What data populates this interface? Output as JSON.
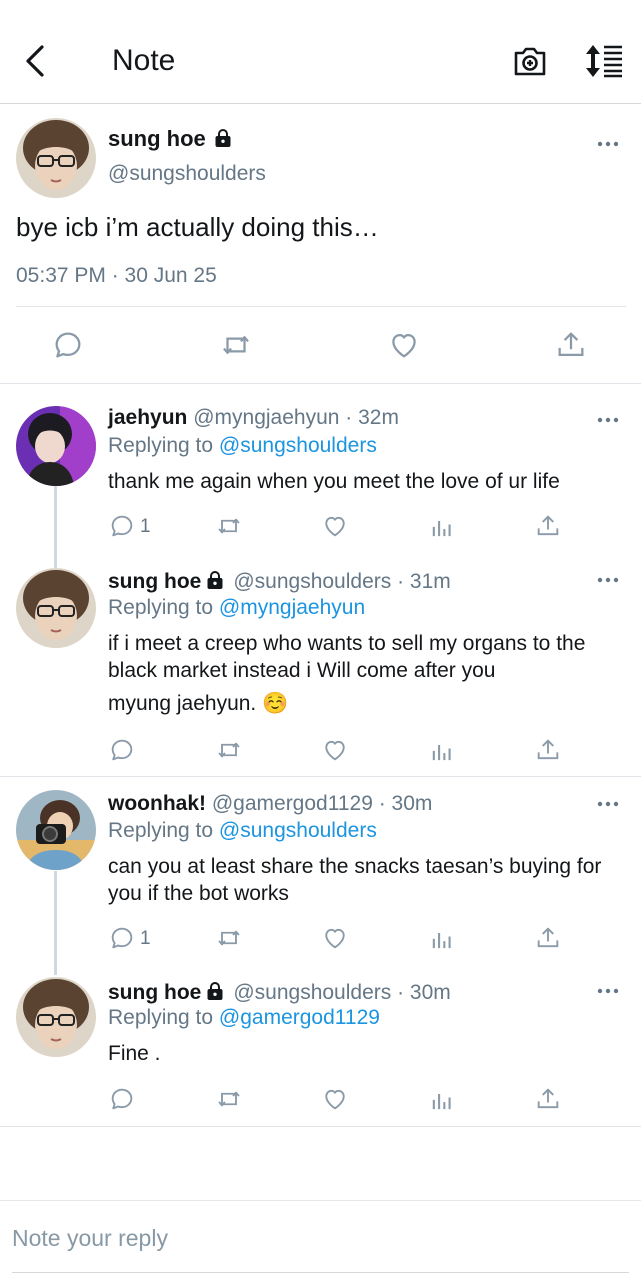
{
  "header": {
    "title": "Note",
    "back_icon": "chevron-left-icon",
    "camera_icon": "camera-icon",
    "sort_icon": "sort-icon"
  },
  "main_note": {
    "name": "sung hoe",
    "handle": "@sungshoulders",
    "text": "bye icb i’m actually doing this…",
    "timestamp": "05:37 PM · 30 Jun 25"
  },
  "replies": [
    {
      "name": "jaehyun",
      "handle": "@myngjaehyun",
      "time": "· 32m",
      "replying_prefix": "Replying to ",
      "replying_to": "@sungshoulders",
      "text": "thank me again when you meet the love of ur life",
      "reply_count": "1"
    },
    {
      "name": "sung hoe",
      "handle": "@sungshoulders",
      "time": "· 31m",
      "replying_prefix": "Replying to ",
      "replying_to": "@myngjaehyun",
      "text": "if i meet a creep who wants to sell my organs to the black market instead i Will come after you",
      "text2": "myung jaehyun. ☺️",
      "reply_count": ""
    },
    {
      "name": "woonhak!",
      "handle": "@gamergod1129",
      "time": "· 30m",
      "replying_prefix": "Replying to ",
      "replying_to": "@sungshoulders",
      "text": "can you at least share the snacks taesan’s buying for you if the bot works",
      "reply_count": "1"
    },
    {
      "name": "sung hoe",
      "handle": "@sungshoulders",
      "time": "· 30m",
      "replying_prefix": "Replying to ",
      "replying_to": "@gamergod1129",
      "text": "Fine .",
      "reply_count": ""
    }
  ],
  "composer": {
    "placeholder": "Note your reply"
  },
  "colors": {
    "accent": "#1b95e0",
    "secondary_text": "#657786",
    "icon": "#8a9aa8"
  }
}
